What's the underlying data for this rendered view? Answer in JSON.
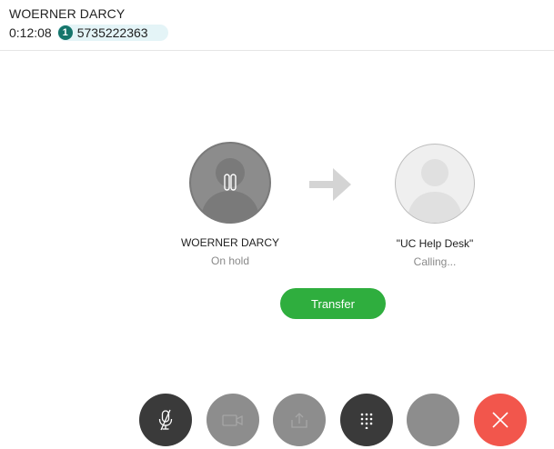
{
  "header": {
    "caller_name": "WOERNER DARCY",
    "duration": "0:12:08",
    "line_badge": "1",
    "line_number": "5735222363"
  },
  "held_party": {
    "name": "WOERNER DARCY",
    "status": "On hold"
  },
  "target_party": {
    "name": "\"UC Help Desk\"",
    "status": "Calling..."
  },
  "transfer": {
    "label": "Transfer"
  },
  "controls": [
    {
      "name": "mute",
      "icon": "microphone-muted-icon",
      "enabled": true
    },
    {
      "name": "video",
      "icon": "video-camera-icon",
      "enabled": false
    },
    {
      "name": "share",
      "icon": "share-upload-icon",
      "enabled": false
    },
    {
      "name": "keypad",
      "icon": "dialpad-icon",
      "enabled": true
    },
    {
      "name": "more",
      "icon": "blank",
      "enabled": false
    },
    {
      "name": "end-call",
      "icon": "close-icon",
      "enabled": true
    }
  ],
  "colors": {
    "transfer_green": "#2fae3e",
    "end_call_red": "#f2564c",
    "badge_teal": "#15756b",
    "pill_bg": "#e4f4f7"
  }
}
